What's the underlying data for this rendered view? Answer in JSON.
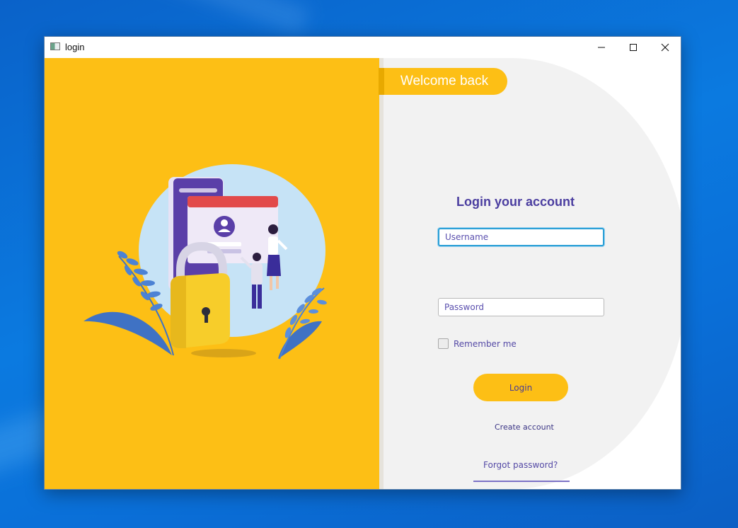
{
  "window": {
    "title": "login"
  },
  "left_panel": {
    "illustration": "security-lock-login-illustration"
  },
  "right_panel": {
    "welcome": "Welcome back",
    "heading": "Login your account",
    "username_placeholder": "Username",
    "password_placeholder": "Password",
    "remember_label": "Remember me",
    "login_label": "Login",
    "create_account": "Create account",
    "forgot_password": "Forgot password?"
  },
  "colors": {
    "accent": "#fdbf15",
    "text_purple": "#4b3ea0",
    "panel_gray": "#f2f2f2",
    "focus_blue": "#2a9fd6"
  },
  "icons": [
    "app-icon",
    "minimize-icon",
    "maximize-icon",
    "close-icon"
  ]
}
